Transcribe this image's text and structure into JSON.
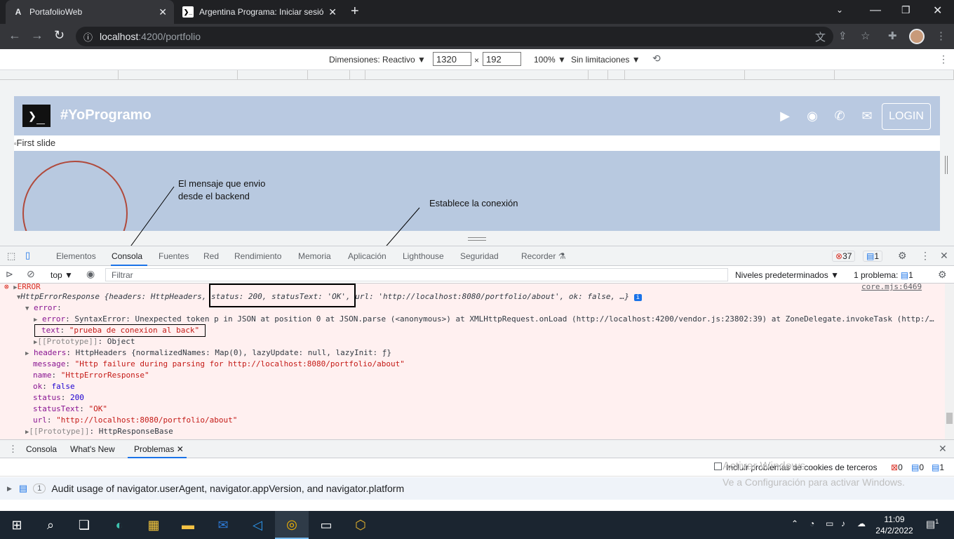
{
  "browser": {
    "tabs": [
      {
        "title": "PortafolioWeb",
        "icon": "angular-icon"
      },
      {
        "title": "Argentina Programa: Iniciar sesió",
        "icon": "terminal-icon"
      }
    ],
    "url_host": "localhost",
    "url_rest": ":4200/portfolio"
  },
  "device_toolbar": {
    "dimensions_label": "Dimensiones: Reactivo ▼",
    "width": "1320",
    "times": "×",
    "height": "192",
    "zoom": "100% ▼",
    "throttle": "Sin limitaciones ▼"
  },
  "site": {
    "logo_glyph": "❯_",
    "brand": "#YoProgramo",
    "login": "LOGIN",
    "slide_alt": "First slide"
  },
  "annotations": {
    "backend_msg_line1": "El mensaje que envio",
    "backend_msg_line2": "desde el backend",
    "connection": "Establece la conexión"
  },
  "devtools": {
    "tabs": [
      "Elementos",
      "Consola",
      "Fuentes",
      "Red",
      "Rendimiento",
      "Memoria",
      "Aplicación",
      "Lighthouse",
      "Seguridad",
      "Recorder ⚗"
    ],
    "error_count": "37",
    "message_count": "1",
    "context": "top",
    "filter_placeholder": "Filtrar",
    "levels": "Niveles predeterminados ▼",
    "problems_label": "1 problema:",
    "problems_count": "1"
  },
  "console": {
    "error_label": "ERROR",
    "source": "core.mjs:6469",
    "summary_pre": "HttpErrorResponse {headers: HttpHeaders, ",
    "summary_box": "status: 200, statusText: 'OK',",
    "summary_post": " url: 'http://localhost:8080/portfolio/about', ok: false, …}",
    "lines": [
      {
        "key": "error",
        "value": ""
      },
      {
        "key": "error",
        "value": "SyntaxError: Unexpected token p in JSON at position 0 at JSON.parse (<anonymous>) at XMLHttpRequest.onLoad (http://localhost:4200/vendor.js:23802:39) at ZoneDelegate.invokeTask (http:/…"
      },
      {
        "key": "text",
        "value": "\"prueba de conexion al back\""
      },
      {
        "key": "[[Prototype]]",
        "value": "Object"
      },
      {
        "key": "headers",
        "value": "HttpHeaders {normalizedNames: Map(0), lazyUpdate: null, lazyInit: ƒ}"
      },
      {
        "key": "message",
        "value": "\"Http failure during parsing for http://localhost:8080/portfolio/about\""
      },
      {
        "key": "name",
        "value": "\"HttpErrorResponse\""
      },
      {
        "key": "ok",
        "value": "false"
      },
      {
        "key": "status",
        "value": "200"
      },
      {
        "key": "statusText",
        "value": "\"OK\""
      },
      {
        "key": "url",
        "value": "\"http://localhost:8080/portfolio/about\""
      },
      {
        "key": "[[Prototype]]",
        "value": "HttpResponseBase"
      }
    ]
  },
  "drawer": {
    "tabs": [
      "Consola",
      "What's New",
      "Problemas"
    ],
    "third_party_label": "Incluir problemas de cookies de terceros",
    "err": "0",
    "warn": "0",
    "info": "1",
    "issue_count": "1",
    "issue_text": "Audit usage of navigator.userAgent, navigator.appVersion, and navigator.platform"
  },
  "watermark": {
    "line1": "Activar Windows",
    "line2": "Ve a Configuración para activar Windows."
  },
  "taskbar": {
    "time": "11:09",
    "date": "24/2/2022",
    "notifications": "1"
  },
  "colors": {
    "site_bg": "#b8c9e0",
    "error_bg": "#fff0f0",
    "accent": "#1a73e8"
  }
}
